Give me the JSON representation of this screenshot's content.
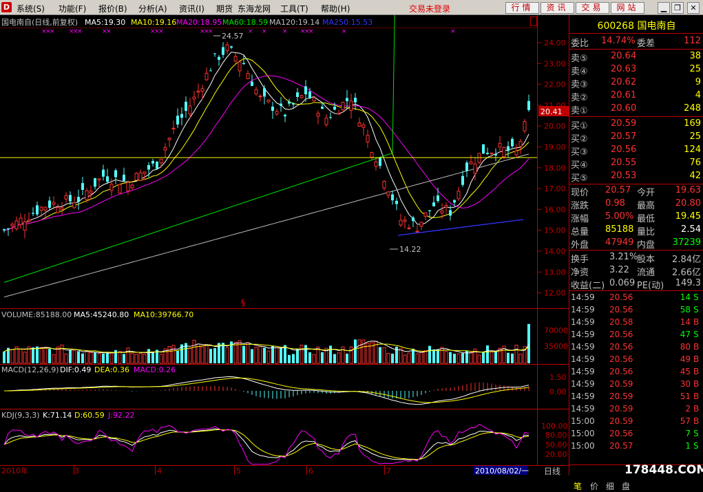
{
  "menu": {
    "items": [
      "系统(S)",
      "功能(F)",
      "报价(B)",
      "分析(A)",
      "资讯(I)",
      "期货",
      "东海龙网",
      "工具(T)",
      "帮助(H)"
    ],
    "status": "交易未登录",
    "quick_buttons": [
      "行情",
      "资讯",
      "交易",
      "网站"
    ]
  },
  "chart": {
    "header": {
      "name": "国电南自(日线,前复权)",
      "ma5": "MA5:19.30",
      "ma10": "MA10:19.16",
      "ma20": "MA20:18.95",
      "ma60": "MA60:18.59",
      "ma120": "MA120:19.14",
      "ma250": "MA250:15.53"
    },
    "price_axis": [
      "24.00",
      "23.00",
      "22.00",
      "21.00",
      "20.00",
      "19.00",
      "18.00",
      "17.00",
      "16.00",
      "15.00",
      "14.00",
      "13.00",
      "12.00"
    ],
    "current_price_tag": "20.41",
    "high_label": "24.57",
    "low_label": "14.22",
    "event_marker": "§",
    "volume": {
      "header": "VOLUME:85188.00",
      "ma5": "MA5:45240.80",
      "ma10": "MA10:39766.70",
      "axis": [
        "70000",
        "35000"
      ]
    },
    "macd": {
      "header": "MACD(12,26,9)",
      "dif": "DIF:0.49",
      "dea": "DEA:0.36",
      "macd": "MACD:0.26",
      "axis": [
        "1.50",
        "0.00"
      ]
    },
    "kdj": {
      "header": "KDJ(9,3,3)",
      "k": "K:71.14",
      "d": "D:60.59",
      "j": "J:92.22",
      "axis": [
        "100.00",
        "80.00",
        "50.00",
        "20.00"
      ]
    },
    "x_axis": [
      "2010年",
      "3",
      "4",
      "5",
      "6",
      "7"
    ],
    "date_cursor": "2010/08/02/一",
    "colors": {
      "up": "#ff3232",
      "down": "#54fcfc",
      "ma5": "#ffffff",
      "ma10": "#ffff00",
      "ma20": "#ff00ff",
      "ma60": "#00e000",
      "ma120": "#c0c0c0",
      "ma250": "#3333ff",
      "grid": "#800000",
      "axis": "#c00000"
    }
  },
  "panel": {
    "code": "600268",
    "name": "国电南自",
    "weibi_label": "委比",
    "weibi_value": "14.74%",
    "weicha_label": "委差",
    "weicha_value": "112",
    "asks": [
      {
        "label": "卖⑤",
        "price": "20.64",
        "vol": "38"
      },
      {
        "label": "卖④",
        "price": "20.63",
        "vol": "25"
      },
      {
        "label": "卖③",
        "price": "20.62",
        "vol": "9"
      },
      {
        "label": "卖②",
        "price": "20.61",
        "vol": "4"
      },
      {
        "label": "卖①",
        "price": "20.60",
        "vol": "248"
      }
    ],
    "bids": [
      {
        "label": "买①",
        "price": "20.59",
        "vol": "169"
      },
      {
        "label": "买②",
        "price": "20.57",
        "vol": "25"
      },
      {
        "label": "买③",
        "price": "20.56",
        "vol": "124"
      },
      {
        "label": "买④",
        "price": "20.55",
        "vol": "76"
      },
      {
        "label": "买⑤",
        "price": "20.53",
        "vol": "42"
      }
    ],
    "stats": [
      {
        "l1": "现价",
        "v1": "20.57",
        "c1": "#ff3232",
        "l2": "今开",
        "v2": "19.63",
        "c2": "#ff3232"
      },
      {
        "l1": "涨跌",
        "v1": "0.98",
        "c1": "#ff3232",
        "l2": "最高",
        "v2": "20.80",
        "c2": "#ff3232"
      },
      {
        "l1": "涨幅",
        "v1": "5.00%",
        "c1": "#ff3232",
        "l2": "最低",
        "v2": "19.45",
        "c2": "#ffff00"
      },
      {
        "l1": "总量",
        "v1": "85188",
        "c1": "#ffff00",
        "l2": "量比",
        "v2": "2.54",
        "c2": "#ffffff"
      },
      {
        "l1": "外盘",
        "v1": "47949",
        "c1": "#ff3232",
        "l2": "内盘",
        "v2": "37239",
        "c2": "#00ff00"
      }
    ],
    "stats2": [
      {
        "l1": "换手",
        "v1": "3.21%",
        "l2": "股本",
        "v2": "2.84亿"
      },
      {
        "l1": "净资",
        "v1": "3.22",
        "l2": "流通",
        "v2": "2.66亿"
      },
      {
        "l1": "收益(二)",
        "v1": "0.069",
        "l2": "PE(动)",
        "v2": "149.3"
      }
    ],
    "trades": [
      {
        "time": "14:59",
        "price": "20.56",
        "vol": "14",
        "side": "S"
      },
      {
        "time": "14:59",
        "price": "20.56",
        "vol": "58",
        "side": "S"
      },
      {
        "time": "14:59",
        "price": "20.58",
        "vol": "14",
        "side": "B"
      },
      {
        "time": "14:59",
        "price": "20.56",
        "vol": "47",
        "side": "S"
      },
      {
        "time": "14:59",
        "price": "20.56",
        "vol": "80",
        "side": "B"
      },
      {
        "time": "14:59",
        "price": "20.56",
        "vol": "49",
        "side": "B"
      },
      {
        "time": "14:59",
        "price": "20.56",
        "vol": "45",
        "side": "B"
      },
      {
        "time": "14:59",
        "price": "20.59",
        "vol": "30",
        "side": "B"
      },
      {
        "time": "14:59",
        "price": "20.59",
        "vol": "51",
        "side": "B"
      },
      {
        "time": "14:59",
        "price": "20.59",
        "vol": "2",
        "side": "B"
      },
      {
        "time": "15:00",
        "price": "20.59",
        "vol": "57",
        "side": "B"
      },
      {
        "time": "15:00",
        "price": "20.56",
        "vol": "7",
        "side": "S"
      },
      {
        "time": "15:00",
        "price": "20.57",
        "vol": "1",
        "side": "S"
      }
    ],
    "bottom_tabs": [
      "笔",
      "价",
      "细",
      "盘"
    ],
    "period_tab": "日线",
    "watermark": "178448.COM"
  }
}
